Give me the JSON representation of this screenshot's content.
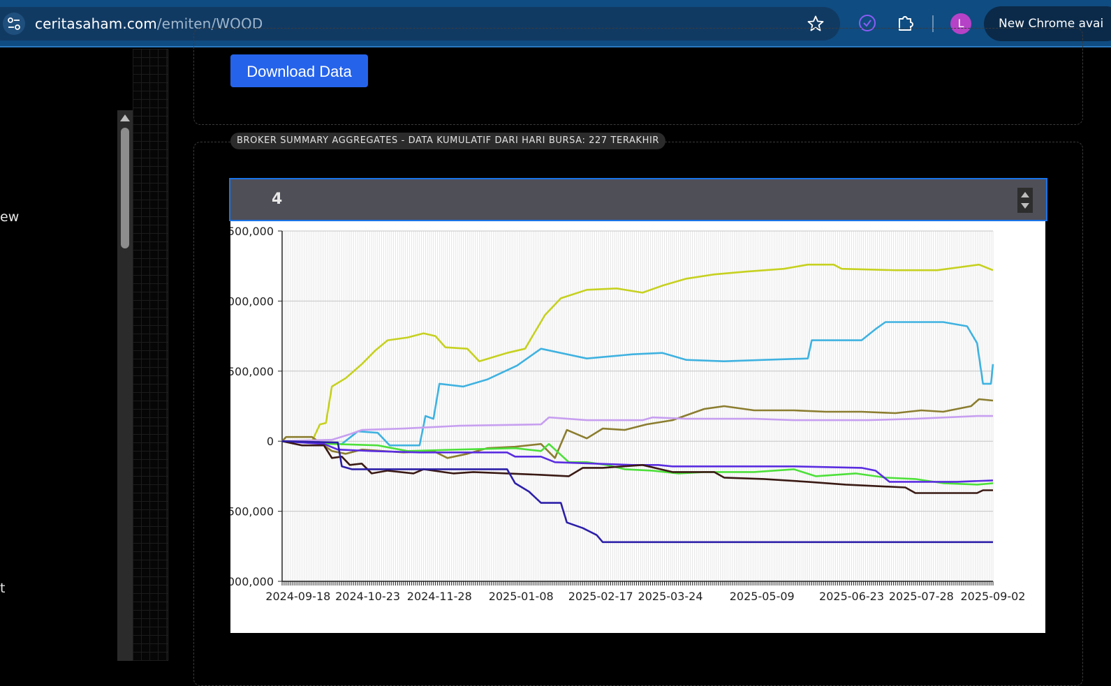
{
  "browser": {
    "url_host": "ceritasaham.com",
    "url_path": "/emiten/WOOD",
    "avatar_letter": "L",
    "update_label": "New Chrome avai"
  },
  "sidebar": {
    "partial_texts": [
      "ew",
      "t"
    ]
  },
  "download": {
    "label": "Download Data"
  },
  "broker_summary": {
    "title": "BROKER SUMMARY AGGREGATES - DATA KUMULATIF DARI HARI BURSA: 227 TERAKHIR",
    "top_n_value": "4"
  },
  "chart_data": {
    "type": "line",
    "ylim": [
      -1000000,
      1500000
    ],
    "y_ticks": [
      -1000000,
      -500000,
      0,
      500000,
      1000000,
      1500000
    ],
    "y_tick_labels": [
      "000,000",
      "500,000",
      "0",
      "500,000",
      "000,000",
      "500,000"
    ],
    "x_range": [
      "2024-09-10",
      "2025-09-02"
    ],
    "x_tick_labels": [
      "2024-09-18",
      "2024-10-23",
      "2024-11-28",
      "2025-01-08",
      "2025-02-17",
      "2025-03-24",
      "2025-05-09",
      "2025-06-23",
      "2025-07-28",
      "2025-09-02"
    ],
    "grid": true,
    "legend": "none",
    "series": [
      {
        "color": "#c6d11f",
        "points": [
          [
            "2024-09-10",
            0
          ],
          [
            "2024-09-25",
            0
          ],
          [
            "2024-09-29",
            120000
          ],
          [
            "2024-10-02",
            130000
          ],
          [
            "2024-10-05",
            390000
          ],
          [
            "2024-10-12",
            450000
          ],
          [
            "2024-10-20",
            550000
          ],
          [
            "2024-10-27",
            650000
          ],
          [
            "2024-11-02",
            720000
          ],
          [
            "2024-11-12",
            740000
          ],
          [
            "2024-11-20",
            770000
          ],
          [
            "2024-11-26",
            750000
          ],
          [
            "2024-12-01",
            670000
          ],
          [
            "2024-12-12",
            660000
          ],
          [
            "2024-12-18",
            570000
          ],
          [
            "2025-01-01",
            630000
          ],
          [
            "2025-01-10",
            660000
          ],
          [
            "2025-01-20",
            900000
          ],
          [
            "2025-01-28",
            1020000
          ],
          [
            "2025-02-10",
            1080000
          ],
          [
            "2025-02-25",
            1090000
          ],
          [
            "2025-03-10",
            1060000
          ],
          [
            "2025-03-20",
            1110000
          ],
          [
            "2025-04-01",
            1160000
          ],
          [
            "2025-04-15",
            1190000
          ],
          [
            "2025-05-01",
            1210000
          ],
          [
            "2025-05-20",
            1230000
          ],
          [
            "2025-06-01",
            1260000
          ],
          [
            "2025-06-14",
            1260000
          ],
          [
            "2025-06-18",
            1230000
          ],
          [
            "2025-07-15",
            1220000
          ],
          [
            "2025-08-05",
            1220000
          ],
          [
            "2025-08-26",
            1260000
          ],
          [
            "2025-09-02",
            1220000
          ]
        ]
      },
      {
        "color": "#3fb2e0",
        "points": [
          [
            "2024-09-10",
            0
          ],
          [
            "2024-10-10",
            -20000
          ],
          [
            "2024-10-18",
            70000
          ],
          [
            "2024-10-28",
            60000
          ],
          [
            "2024-11-03",
            -30000
          ],
          [
            "2024-11-18",
            -30000
          ],
          [
            "2024-11-21",
            180000
          ],
          [
            "2024-11-25",
            160000
          ],
          [
            "2024-11-28",
            410000
          ],
          [
            "2024-12-10",
            390000
          ],
          [
            "2024-12-22",
            440000
          ],
          [
            "2025-01-06",
            540000
          ],
          [
            "2025-01-18",
            660000
          ],
          [
            "2025-02-10",
            590000
          ],
          [
            "2025-03-05",
            620000
          ],
          [
            "2025-03-20",
            630000
          ],
          [
            "2025-04-01",
            580000
          ],
          [
            "2025-04-20",
            570000
          ],
          [
            "2025-05-10",
            580000
          ],
          [
            "2025-06-01",
            590000
          ],
          [
            "2025-06-03",
            720000
          ],
          [
            "2025-06-28",
            720000
          ],
          [
            "2025-07-05",
            800000
          ],
          [
            "2025-07-10",
            850000
          ],
          [
            "2025-08-08",
            850000
          ],
          [
            "2025-08-20",
            820000
          ],
          [
            "2025-08-25",
            700000
          ],
          [
            "2025-08-28",
            410000
          ],
          [
            "2025-09-01",
            410000
          ],
          [
            "2025-09-02",
            550000
          ]
        ]
      },
      {
        "color": "#8b7d2f",
        "points": [
          [
            "2024-09-10",
            0
          ],
          [
            "2024-09-12",
            30000
          ],
          [
            "2024-09-25",
            30000
          ],
          [
            "2024-10-05",
            -70000
          ],
          [
            "2024-10-12",
            -90000
          ],
          [
            "2024-10-20",
            -60000
          ],
          [
            "2024-11-10",
            -80000
          ],
          [
            "2024-11-25",
            -70000
          ],
          [
            "2024-12-02",
            -120000
          ],
          [
            "2024-12-12",
            -90000
          ],
          [
            "2024-12-22",
            -50000
          ],
          [
            "2025-01-05",
            -40000
          ],
          [
            "2025-01-18",
            -20000
          ],
          [
            "2025-01-25",
            -120000
          ],
          [
            "2025-01-31",
            80000
          ],
          [
            "2025-02-10",
            20000
          ],
          [
            "2025-02-18",
            90000
          ],
          [
            "2025-03-01",
            80000
          ],
          [
            "2025-03-12",
            120000
          ],
          [
            "2025-03-25",
            150000
          ],
          [
            "2025-04-10",
            230000
          ],
          [
            "2025-04-20",
            250000
          ],
          [
            "2025-05-05",
            220000
          ],
          [
            "2025-05-25",
            220000
          ],
          [
            "2025-06-10",
            210000
          ],
          [
            "2025-06-28",
            210000
          ],
          [
            "2025-07-15",
            200000
          ],
          [
            "2025-07-28",
            220000
          ],
          [
            "2025-08-08",
            210000
          ],
          [
            "2025-08-22",
            250000
          ],
          [
            "2025-08-26",
            300000
          ],
          [
            "2025-09-02",
            290000
          ]
        ]
      },
      {
        "color": "#c79ff0",
        "points": [
          [
            "2024-09-10",
            0
          ],
          [
            "2024-10-05",
            10000
          ],
          [
            "2024-10-14",
            50000
          ],
          [
            "2024-10-20",
            80000
          ],
          [
            "2024-11-10",
            90000
          ],
          [
            "2024-12-08",
            110000
          ],
          [
            "2025-01-18",
            120000
          ],
          [
            "2025-01-22",
            170000
          ],
          [
            "2025-02-10",
            150000
          ],
          [
            "2025-03-10",
            150000
          ],
          [
            "2025-03-15",
            170000
          ],
          [
            "2025-04-01",
            160000
          ],
          [
            "2025-05-05",
            160000
          ],
          [
            "2025-05-25",
            150000
          ],
          [
            "2025-07-01",
            150000
          ],
          [
            "2025-07-25",
            160000
          ],
          [
            "2025-08-25",
            180000
          ],
          [
            "2025-09-02",
            180000
          ]
        ]
      },
      {
        "color": "#4de03a",
        "points": [
          [
            "2024-09-10",
            0
          ],
          [
            "2024-10-05",
            -20000
          ],
          [
            "2024-10-28",
            -30000
          ],
          [
            "2024-11-12",
            -70000
          ],
          [
            "2024-12-08",
            -60000
          ],
          [
            "2025-01-05",
            -50000
          ],
          [
            "2025-01-18",
            -70000
          ],
          [
            "2025-01-22",
            -20000
          ],
          [
            "2025-02-01",
            -150000
          ],
          [
            "2025-02-10",
            -150000
          ],
          [
            "2025-02-20",
            -170000
          ],
          [
            "2025-03-01",
            -200000
          ],
          [
            "2025-03-15",
            -210000
          ],
          [
            "2025-03-28",
            -230000
          ],
          [
            "2025-04-10",
            -220000
          ],
          [
            "2025-05-05",
            -220000
          ],
          [
            "2025-05-25",
            -200000
          ],
          [
            "2025-06-05",
            -250000
          ],
          [
            "2025-06-25",
            -230000
          ],
          [
            "2025-07-10",
            -260000
          ],
          [
            "2025-07-25",
            -270000
          ],
          [
            "2025-08-08",
            -300000
          ],
          [
            "2025-08-25",
            -310000
          ],
          [
            "2025-09-02",
            -300000
          ]
        ]
      },
      {
        "color": "#5a2de0",
        "points": [
          [
            "2024-09-10",
            0
          ],
          [
            "2024-10-01",
            -20000
          ],
          [
            "2024-10-08",
            -60000
          ],
          [
            "2024-10-25",
            -70000
          ],
          [
            "2024-11-18",
            -80000
          ],
          [
            "2025-01-01",
            -80000
          ],
          [
            "2025-01-05",
            -110000
          ],
          [
            "2025-01-18",
            -110000
          ],
          [
            "2025-01-25",
            -150000
          ],
          [
            "2025-03-05",
            -170000
          ],
          [
            "2025-03-18",
            -170000
          ],
          [
            "2025-03-25",
            -180000
          ],
          [
            "2025-05-25",
            -180000
          ],
          [
            "2025-06-28",
            -190000
          ],
          [
            "2025-07-05",
            -210000
          ],
          [
            "2025-07-12",
            -290000
          ],
          [
            "2025-08-15",
            -290000
          ],
          [
            "2025-09-02",
            -280000
          ]
        ]
      },
      {
        "color": "#3a1a14",
        "points": [
          [
            "2024-09-10",
            0
          ],
          [
            "2024-09-20",
            -30000
          ],
          [
            "2024-10-01",
            -30000
          ],
          [
            "2024-10-05",
            -120000
          ],
          [
            "2024-10-10",
            -110000
          ],
          [
            "2024-10-14",
            -170000
          ],
          [
            "2024-10-20",
            -160000
          ],
          [
            "2024-10-25",
            -230000
          ],
          [
            "2024-11-02",
            -210000
          ],
          [
            "2024-11-15",
            -230000
          ],
          [
            "2024-11-20",
            -200000
          ],
          [
            "2024-12-05",
            -230000
          ],
          [
            "2024-12-15",
            -220000
          ],
          [
            "2025-01-18",
            -240000
          ],
          [
            "2025-02-01",
            -250000
          ],
          [
            "2025-02-08",
            -190000
          ],
          [
            "2025-02-18",
            -190000
          ],
          [
            "2025-03-10",
            -170000
          ],
          [
            "2025-03-25",
            -220000
          ],
          [
            "2025-04-15",
            -220000
          ],
          [
            "2025-04-20",
            -260000
          ],
          [
            "2025-05-10",
            -270000
          ],
          [
            "2025-06-01",
            -290000
          ],
          [
            "2025-06-20",
            -310000
          ],
          [
            "2025-07-20",
            -330000
          ],
          [
            "2025-07-25",
            -370000
          ],
          [
            "2025-08-25",
            -370000
          ],
          [
            "2025-08-28",
            -350000
          ],
          [
            "2025-09-02",
            -350000
          ]
        ]
      },
      {
        "color": "#2c1fa8",
        "points": [
          [
            "2024-09-10",
            0
          ],
          [
            "2024-10-08",
            -10000
          ],
          [
            "2024-10-10",
            -180000
          ],
          [
            "2024-10-15",
            -200000
          ],
          [
            "2024-11-10",
            -200000
          ],
          [
            "2025-01-01",
            -200000
          ],
          [
            "2025-01-05",
            -300000
          ],
          [
            "2025-01-12",
            -360000
          ],
          [
            "2025-01-18",
            -440000
          ],
          [
            "2025-01-28",
            -440000
          ],
          [
            "2025-01-31",
            -580000
          ],
          [
            "2025-02-08",
            -620000
          ],
          [
            "2025-02-15",
            -670000
          ],
          [
            "2025-02-18",
            -720000
          ],
          [
            "2025-09-02",
            -720000
          ]
        ]
      }
    ]
  }
}
